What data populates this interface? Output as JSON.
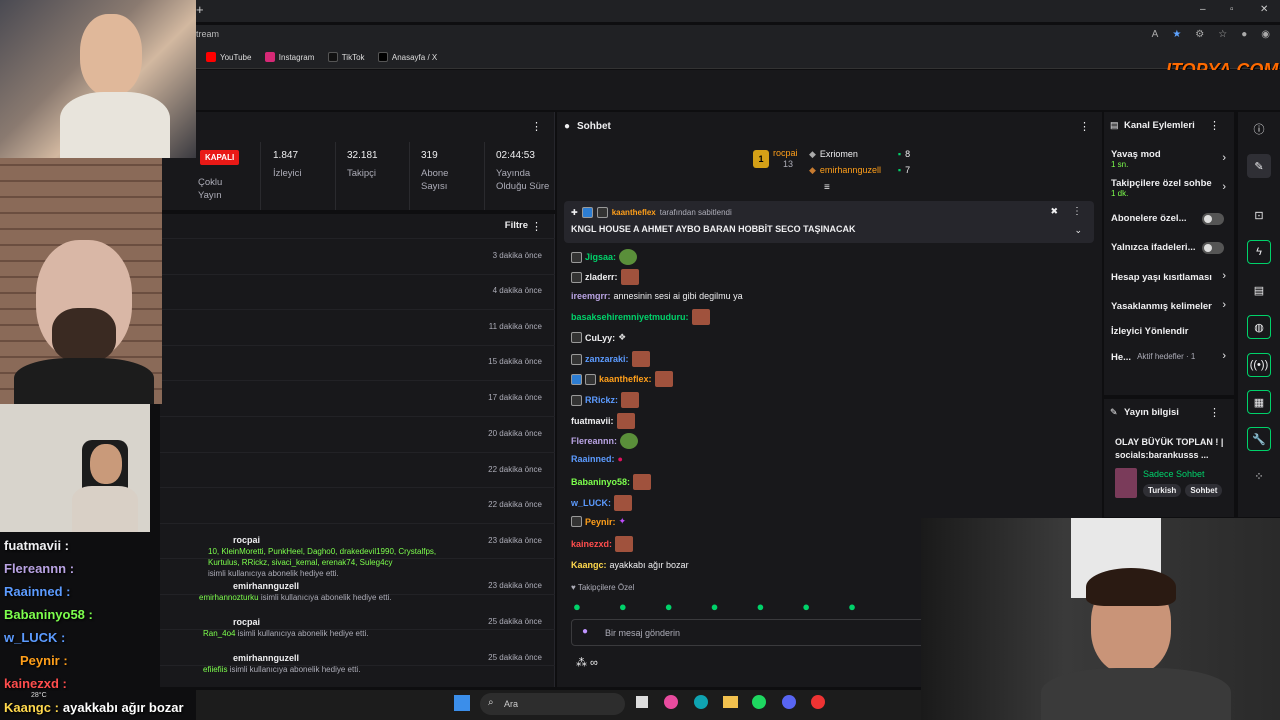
{
  "browser": {
    "url_fragment": "tream",
    "bookmarks": [
      "YouTube",
      "Instagram",
      "TikTok",
      "Anasayfa / X"
    ],
    "watermark": "ITOPYA.COM"
  },
  "stream_panel": {
    "status_badge": "KAPALI",
    "mode_label": "Çoklu Yayın",
    "stats": [
      {
        "value": "1.847",
        "label": "İzleyici"
      },
      {
        "value": "32.181",
        "label": "Takipçi"
      },
      {
        "value": "319",
        "label": "Abone Sayısı"
      },
      {
        "value": "02:44:53",
        "label": "Yayında Olduğu Süre"
      }
    ],
    "filter_label": "Filtre",
    "times": [
      "3 dakika önce",
      "4 dakika önce",
      "11 dakika önce",
      "15 dakika önce",
      "17 dakika önce",
      "20 dakika önce",
      "22 dakika önce",
      "22 dakika önce",
      "23 dakika önce",
      "23 dakika önce",
      "25 dakika önce",
      "25 dakika önce"
    ],
    "events": [
      {
        "user": "rocpai",
        "names": "10, KleinMoretti, PunkHeel, Dagho0, drakedevil1990, Crystalfps, Kurtulus, RRickz, sivaci_kemal, erenak74, Suleg4cy",
        "text": "isimli kullanıcıya abonelik hediye etti."
      },
      {
        "user": "emirhannguzell",
        "names": "emirhannozturku",
        "text": "isimli kullanıcıya abonelik hediye etti."
      },
      {
        "user": "rocpai",
        "names": "Ran_4o4",
        "text": "isimli kullanıcıya abonelik hediye etti."
      },
      {
        "user": "emirhannguzell",
        "names": "efiiefiis",
        "text": "isimli kullanıcıya abonelik hediye etti."
      }
    ]
  },
  "chat": {
    "title": "Sohbet",
    "leaderboard": [
      {
        "rank": "1",
        "name": "rocpai",
        "count": "13"
      },
      {
        "name": "Exriomen",
        "count": "8"
      },
      {
        "name": "emirhannguzell",
        "count": "7"
      }
    ],
    "pinned": {
      "by_user": "kaantheflex",
      "by_text": "tarafından sabitlendi",
      "message": "KNGL HOUSE A AHMET AYBO BARAN HOBBİT SECO TAŞINACAK"
    },
    "messages": [
      {
        "user": "Jigsaa:",
        "text": "",
        "color": "#00d26a"
      },
      {
        "user": "zladerr:",
        "text": "",
        "color": "#efeff1"
      },
      {
        "user": "ireemgrr:",
        "text": "annesinin sesi ai gibi degilmu ya",
        "color": "#b9a3e3"
      },
      {
        "user": "basaksehiremniyetmuduru:",
        "text": "",
        "color": "#00d26a"
      },
      {
        "user": "CuLyy:",
        "text": "",
        "color": "#efeff1"
      },
      {
        "user": "zanzaraki:",
        "text": "",
        "color": "#5c9bff"
      },
      {
        "user": "kaantheflex:",
        "text": "",
        "color": "#ff9f1a"
      },
      {
        "user": "RRickz:",
        "text": "",
        "color": "#5c9bff"
      },
      {
        "user": "fuatmavii:",
        "text": "",
        "color": "#efeff1"
      },
      {
        "user": "Flereannn:",
        "text": "",
        "color": "#b9a3e3"
      },
      {
        "user": "Raainned:",
        "text": "",
        "color": "#5c9bff"
      },
      {
        "user": "Babaninyo58:",
        "text": "",
        "color": "#7dff4d"
      },
      {
        "user": "w_LUCK:",
        "text": "",
        "color": "#5c9bff"
      },
      {
        "user": "Peynir:",
        "text": "",
        "color": "#ff9f1a"
      },
      {
        "user": "kainezxd:",
        "text": "",
        "color": "#ff4d4d"
      },
      {
        "user": "Kaangc:",
        "text": "ayakkabı ağır bozar",
        "color": "#ffd84d"
      }
    ],
    "followers_only": "Takipçilere Özel",
    "input_placeholder": "Bir mesaj gönderin"
  },
  "channel_actions": {
    "title": "Kanal Eylemleri",
    "items": [
      {
        "label": "Yavaş mod",
        "sub": "1 sn."
      },
      {
        "label": "Takipçilere özel sohbe",
        "sub": "1 dk."
      },
      {
        "label": "Abonelere özel..."
      },
      {
        "label": "Yalnızca ifadeleri..."
      },
      {
        "label": "Hesap yaşı kısıtlaması"
      },
      {
        "label": "Yasaklanmış kelimeler"
      },
      {
        "label": "İzleyici Yönlendir"
      },
      {
        "label": "He...",
        "sub": "Aktif hedefler · 1"
      }
    ]
  },
  "stream_info": {
    "title": "Yayın bilgisi",
    "stream_title": "OLAY BÜYÜK TOPLAN ! | socials:barankusss ...",
    "category": "Sadece Sohbet",
    "tags": [
      "Turkish",
      "Sohbet"
    ]
  },
  "overlay_chat": [
    {
      "user": "fuatmavii :",
      "text": "",
      "color": "#efeff1"
    },
    {
      "user": "Flereannn :",
      "text": "",
      "color": "#b9a3e3"
    },
    {
      "user": "Raainned :",
      "text": "",
      "color": "#5c9bff"
    },
    {
      "user": "Babaninyo58 :",
      "text": "",
      "color": "#7dff4d"
    },
    {
      "user": "w_LUCK :",
      "text": "",
      "color": "#5c9bff"
    },
    {
      "user": "Peynir :",
      "text": "",
      "color": "#ff9f1a"
    },
    {
      "user": "kainezxd :",
      "text": "",
      "color": "#ff4d4d"
    },
    {
      "user": "Kaangc :",
      "text": "ayakkabı ağır bozar",
      "color": "#ffd84d"
    }
  ],
  "taskbar": {
    "search_placeholder": "Ara",
    "weather": "28°C"
  }
}
